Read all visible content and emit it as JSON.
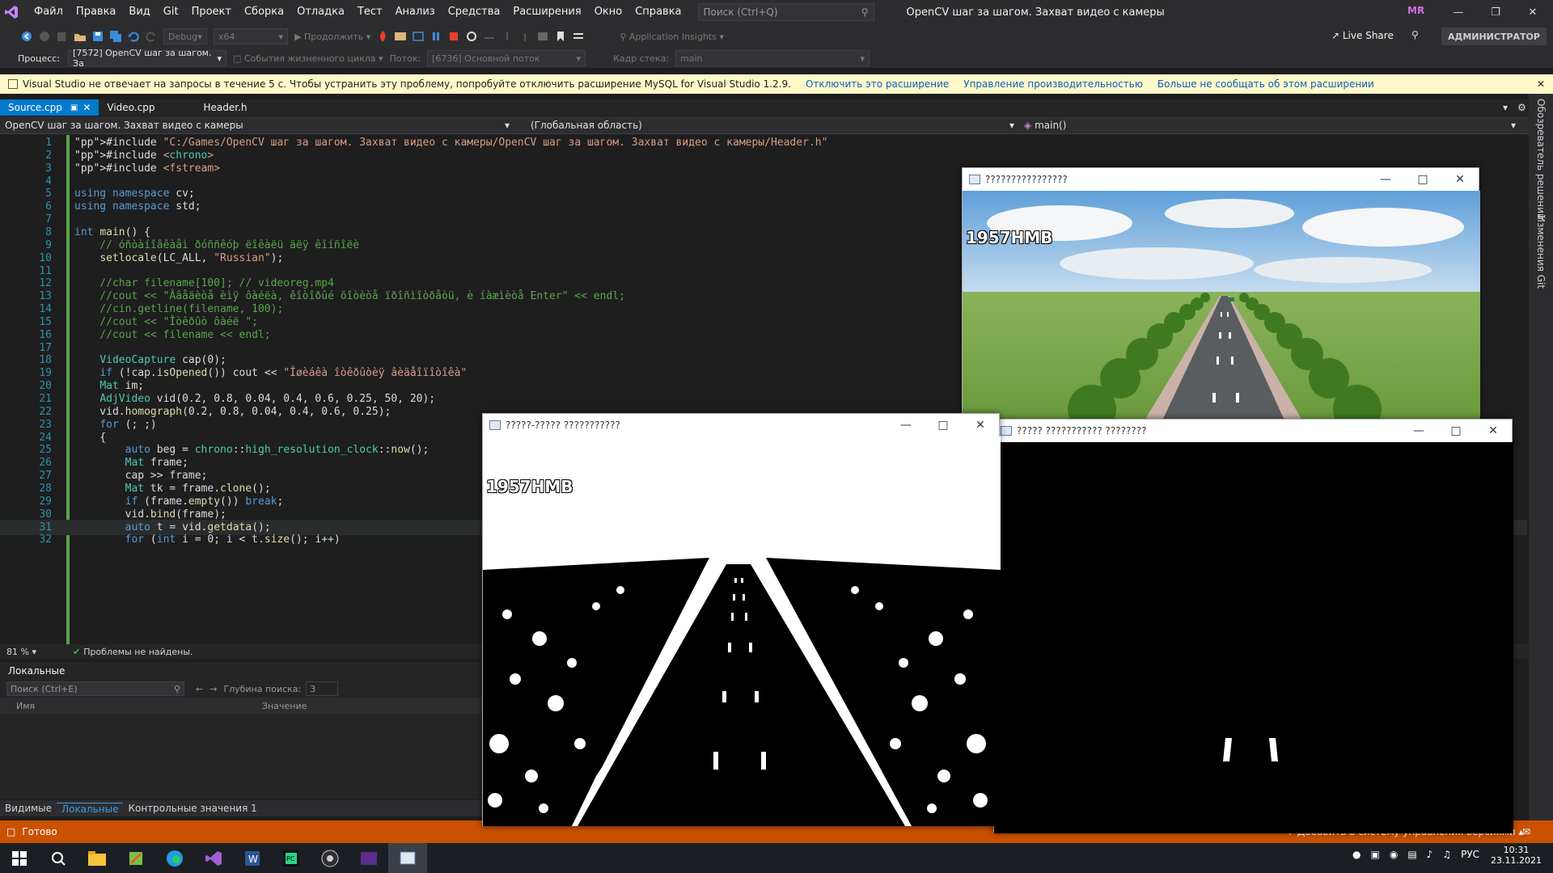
{
  "titlebar": {
    "menu": [
      "Файл",
      "Правка",
      "Вид",
      "Git",
      "Проект",
      "Сборка",
      "Отладка",
      "Тест",
      "Анализ",
      "Средства",
      "Расширения",
      "Окно",
      "Справка"
    ],
    "search_placeholder": "Поиск (Ctrl+Q)",
    "window_title": "OpenCV шаг за шагом. Захват видео с камеры",
    "avatar": "MR"
  },
  "toolbar": {
    "config": "Debug",
    "platform": "x64",
    "continue_label": "Продолжить",
    "app_insights": "Application Insights",
    "live_share": "Live Share",
    "admin": "АДМИНИСТРАТОР"
  },
  "procbar": {
    "process_label": "Процесс:",
    "process_value": "[7572] OpenCV шаг за шагом. За",
    "lifecycle": "События жизненного цикла",
    "thread_label": "Поток:",
    "thread_value": "[6736] Основной поток",
    "frame_label": "Кадр стека:",
    "frame_value": "main"
  },
  "infobar": {
    "message": "Visual Studio не отвечает на запросы в течение 5 с. Чтобы устранить эту проблему, попробуйте отключить расширение MySQL for Visual Studio 1.2.9.",
    "link1": "Отключить это расширение",
    "link2": "Управление производительностью",
    "link3": "Больше не сообщать об этом расширении"
  },
  "tabs": [
    "Source.cpp",
    "Video.cpp",
    "Header.h"
  ],
  "navbar": {
    "project": "OpenCV шаг за шагом. Захват видео с камеры",
    "scope": "(Глобальная область)",
    "member": "main()"
  },
  "code_lines": [
    {
      "n": "1",
      "t": "#include \"C:/Games/OpenCV шаг за шагом. Захват видео с камеры/OpenCV шаг за шагом. Захват видео с камеры/Header.h\""
    },
    {
      "n": "2",
      "t": "#include <chrono>"
    },
    {
      "n": "3",
      "t": "#include <fstream>"
    },
    {
      "n": "4",
      "t": ""
    },
    {
      "n": "5",
      "t": "using namespace cv;"
    },
    {
      "n": "6",
      "t": "using namespace std;"
    },
    {
      "n": "7",
      "t": ""
    },
    {
      "n": "8",
      "t": "int main() {"
    },
    {
      "n": "9",
      "t": "    // óñòàíîâêàåì ðóññêóþ ëîêàëü äëÿ êîíñîëè"
    },
    {
      "n": "10",
      "t": "    setlocale(LC_ALL, \"Russian\");"
    },
    {
      "n": "11",
      "t": ""
    },
    {
      "n": "12",
      "t": "    //char filename[100]; // videoreg.mp4"
    },
    {
      "n": "13",
      "t": "    //cout << \"Ââåäèòå èìÿ ôàéëà, êîòîðûé õîòèòå ïðîñìîòðåòü, è íàæìèòå Enter\" << endl;"
    },
    {
      "n": "14",
      "t": "    //cin.getline(filename, 100);"
    },
    {
      "n": "15",
      "t": "    //cout << \"Îòêðûò ôàéë \";"
    },
    {
      "n": "16",
      "t": "    //cout << filename << endl;"
    },
    {
      "n": "17",
      "t": ""
    },
    {
      "n": "18",
      "t": "    VideoCapture cap(0);"
    },
    {
      "n": "19",
      "t": "    if (!cap.isOpened()) cout << \"Îøèáêà îòêðûòèÿ âèäåîïîòîêà\""
    },
    {
      "n": "20",
      "t": "    Mat im;"
    },
    {
      "n": "21",
      "t": "    AdjVideo vid(0.2, 0.8, 0.04, 0.4, 0.6, 0.25, 50, 20);"
    },
    {
      "n": "22",
      "t": "    vid.homograph(0.2, 0.8, 0.04, 0.4, 0.6, 0.25);"
    },
    {
      "n": "23",
      "t": "    for (; ;)"
    },
    {
      "n": "24",
      "t": "    {"
    },
    {
      "n": "25",
      "t": "        auto beg = chrono::high_resolution_clock::now();"
    },
    {
      "n": "26",
      "t": "        Mat frame;"
    },
    {
      "n": "27",
      "t": "        cap >> frame;"
    },
    {
      "n": "28",
      "t": "        Mat tk = frame.clone();"
    },
    {
      "n": "29",
      "t": "        if (frame.empty()) break;"
    },
    {
      "n": "30",
      "t": "        vid.bind(frame);"
    },
    {
      "n": "31",
      "t": "        auto t = vid.getdata();"
    },
    {
      "n": "32",
      "t": "        for (int i = 0; i < t.size(); i++)"
    }
  ],
  "editor_status": {
    "zoom": "81 %",
    "problems": "Проблемы не найдены."
  },
  "locals": {
    "title": "Локальные",
    "search_placeholder": "Поиск (Ctrl+E)",
    "depth_label": "Глубина поиска:",
    "depth_value": "3",
    "col_name": "Имя",
    "col_value": "Значение"
  },
  "bottom_tabs": [
    "Видимые",
    "Локальные",
    "Контрольные значения 1"
  ],
  "statusbar": {
    "ready": "Готово",
    "git": "Добавить в систему управления версиями"
  },
  "right_rail": [
    "Обозреватель решений",
    "Изменения Git"
  ],
  "cv_windows": [
    {
      "title": "????????????????",
      "plate": "1957HMB"
    },
    {
      "title": "?????-????? ???????????",
      "plate": "1957HMB"
    },
    {
      "title": "????? ??????????? ????????"
    }
  ],
  "tray": {
    "lang": "РУС",
    "time": "10:31",
    "date": "23.11.2021"
  },
  "colors": {
    "accent": "#007acc",
    "status_debug": "#ca5100",
    "info_bar": "#fff8c8"
  }
}
